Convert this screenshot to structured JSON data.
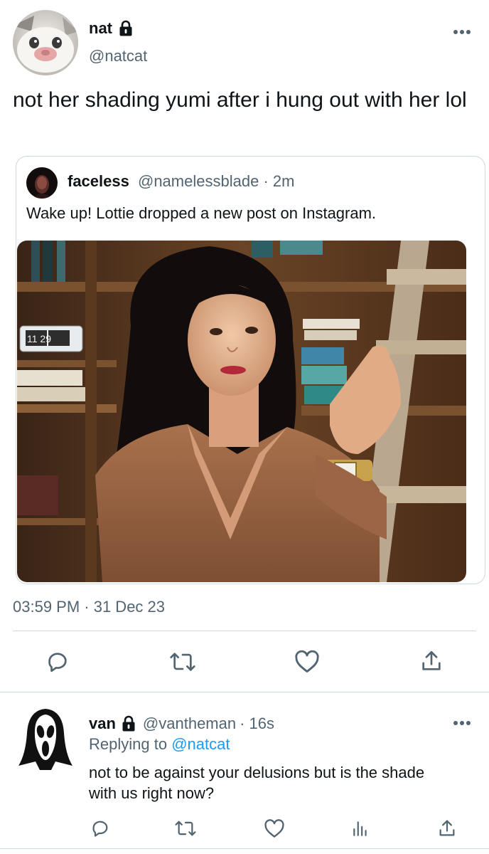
{
  "main_tweet": {
    "author": {
      "name": "nat",
      "handle": "@natcat",
      "protected": true,
      "avatar": "white-cat-photo"
    },
    "text": "not her shading yumi after i hung out with her lol",
    "timestamp": "03:59 PM · 31 Dec 23",
    "quoted": {
      "author": {
        "name": "faceless",
        "handle": "@namelessblade",
        "time": "· 2m",
        "avatar": "dark-portrait-photo"
      },
      "text": "Wake up! Lottie dropped a new post on Instagram.",
      "image": "photo-woman-brown-blazer-bookshelf",
      "clock_digits": "11 29"
    },
    "actions": [
      "reply-icon",
      "retweet-icon",
      "like-icon",
      "share-icon"
    ]
  },
  "reply_tweet": {
    "author": {
      "name": "van",
      "handle": "@vantheman",
      "time": "· 16s",
      "protected": true,
      "avatar": "ghostface-mask"
    },
    "replying_to_label": "Replying to",
    "replying_to": "@natcat",
    "text": "not to be against your delusions but is the shade with us right now?",
    "actions": [
      "reply-icon",
      "retweet-icon",
      "like-icon",
      "views-icon",
      "share-icon"
    ]
  },
  "colors": {
    "accent": "#1d9bf0",
    "text": "#0f1419",
    "muted": "#536471",
    "border": "#cfd9de"
  }
}
